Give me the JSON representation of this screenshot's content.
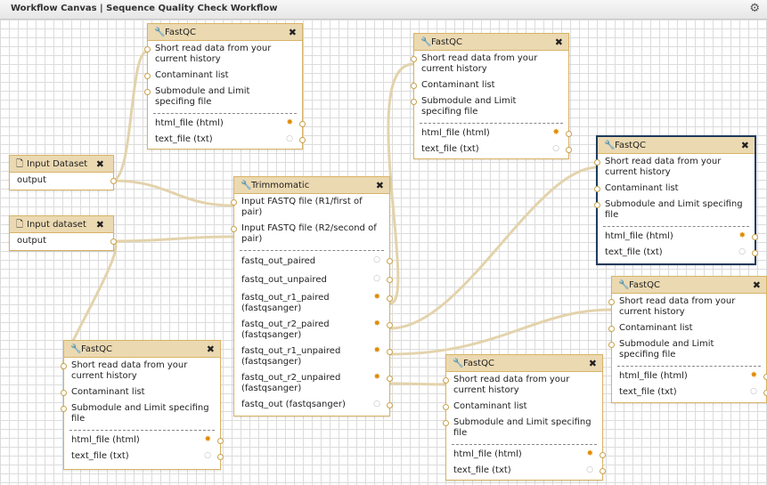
{
  "window": {
    "title": "Workflow Canvas | Sequence Quality Check Workflow",
    "settings_icon": "gear-icon"
  },
  "inputs": [
    {
      "title": "Input Dataset",
      "output": "output"
    },
    {
      "title": "Input dataset",
      "output": "output"
    }
  ],
  "fastqc_labels": {
    "title": "FastQC",
    "in1": "Short read data from your current history",
    "in2": "Contaminant list",
    "in3": "Submodule and Limit specifing file",
    "out1": "html_file (html)",
    "out2": "text_file (txt)"
  },
  "trimmomatic": {
    "title": "Trimmomatic",
    "in1": "Input FASTQ file (R1/first of pair)",
    "in2": "Input FASTQ file (R2/second of pair)",
    "outputs": [
      "fastq_out_paired",
      "fastq_out_unpaired",
      "fastq_out_r1_paired (fastqsanger)",
      "fastq_out_r2_paired (fastqsanger)",
      "fastq_out_r1_unpaired (fastqsanger)",
      "fastq_out_r2_unpaired (fastqsanger)",
      "fastq_out (fastqsanger)"
    ]
  },
  "icons": {
    "tool": "wrench-icon",
    "input": "file-icon",
    "close": "close-icon"
  },
  "colors": {
    "node_header": "#ebd9b2",
    "node_border": "#d8b365",
    "active_border": "#1f3a5c",
    "wire": "#e3d3ac",
    "marked_output": "#e08a00"
  }
}
